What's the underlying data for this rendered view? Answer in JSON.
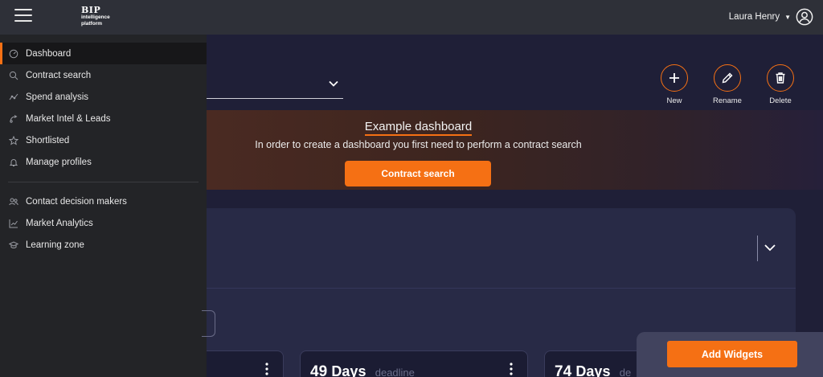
{
  "app": {
    "logo_brand": "BIP",
    "logo_line1": "intelligence",
    "logo_line2": "platform"
  },
  "header": {
    "user_name": "Laura Henry"
  },
  "sidebar": {
    "items": [
      {
        "label": "Dashboard",
        "icon": "dashboard-icon",
        "active": true
      },
      {
        "label": "Contract search",
        "icon": "search-icon"
      },
      {
        "label": "Spend analysis",
        "icon": "spend-icon"
      },
      {
        "label": "Market Intel & Leads",
        "icon": "market-intel-icon"
      },
      {
        "label": "Shortlisted",
        "icon": "star-icon"
      },
      {
        "label": "Manage profiles",
        "icon": "bell-icon"
      }
    ],
    "items2": [
      {
        "label": "Contact decision makers",
        "icon": "contacts-icon"
      },
      {
        "label": "Market Analytics",
        "icon": "analytics-icon"
      },
      {
        "label": "Learning zone",
        "icon": "graduation-icon"
      }
    ]
  },
  "toolbar": {
    "new_label": "New",
    "rename_label": "Rename",
    "delete_label": "Delete"
  },
  "banner": {
    "title": "Example dashboard",
    "text": "In order to create a dashboard you first need to perform a contract search",
    "button": "Contract search"
  },
  "cards": [
    {
      "number": "49",
      "unit": "Days",
      "caption": "deadline"
    },
    {
      "number": "74",
      "unit": "Days",
      "caption": "de"
    }
  ],
  "widgets": {
    "button": "Add Widgets"
  },
  "colors": {
    "accent": "#f57014",
    "topbar": "#2e3038",
    "sidebar": "#232427",
    "background": "#1f1f37"
  }
}
